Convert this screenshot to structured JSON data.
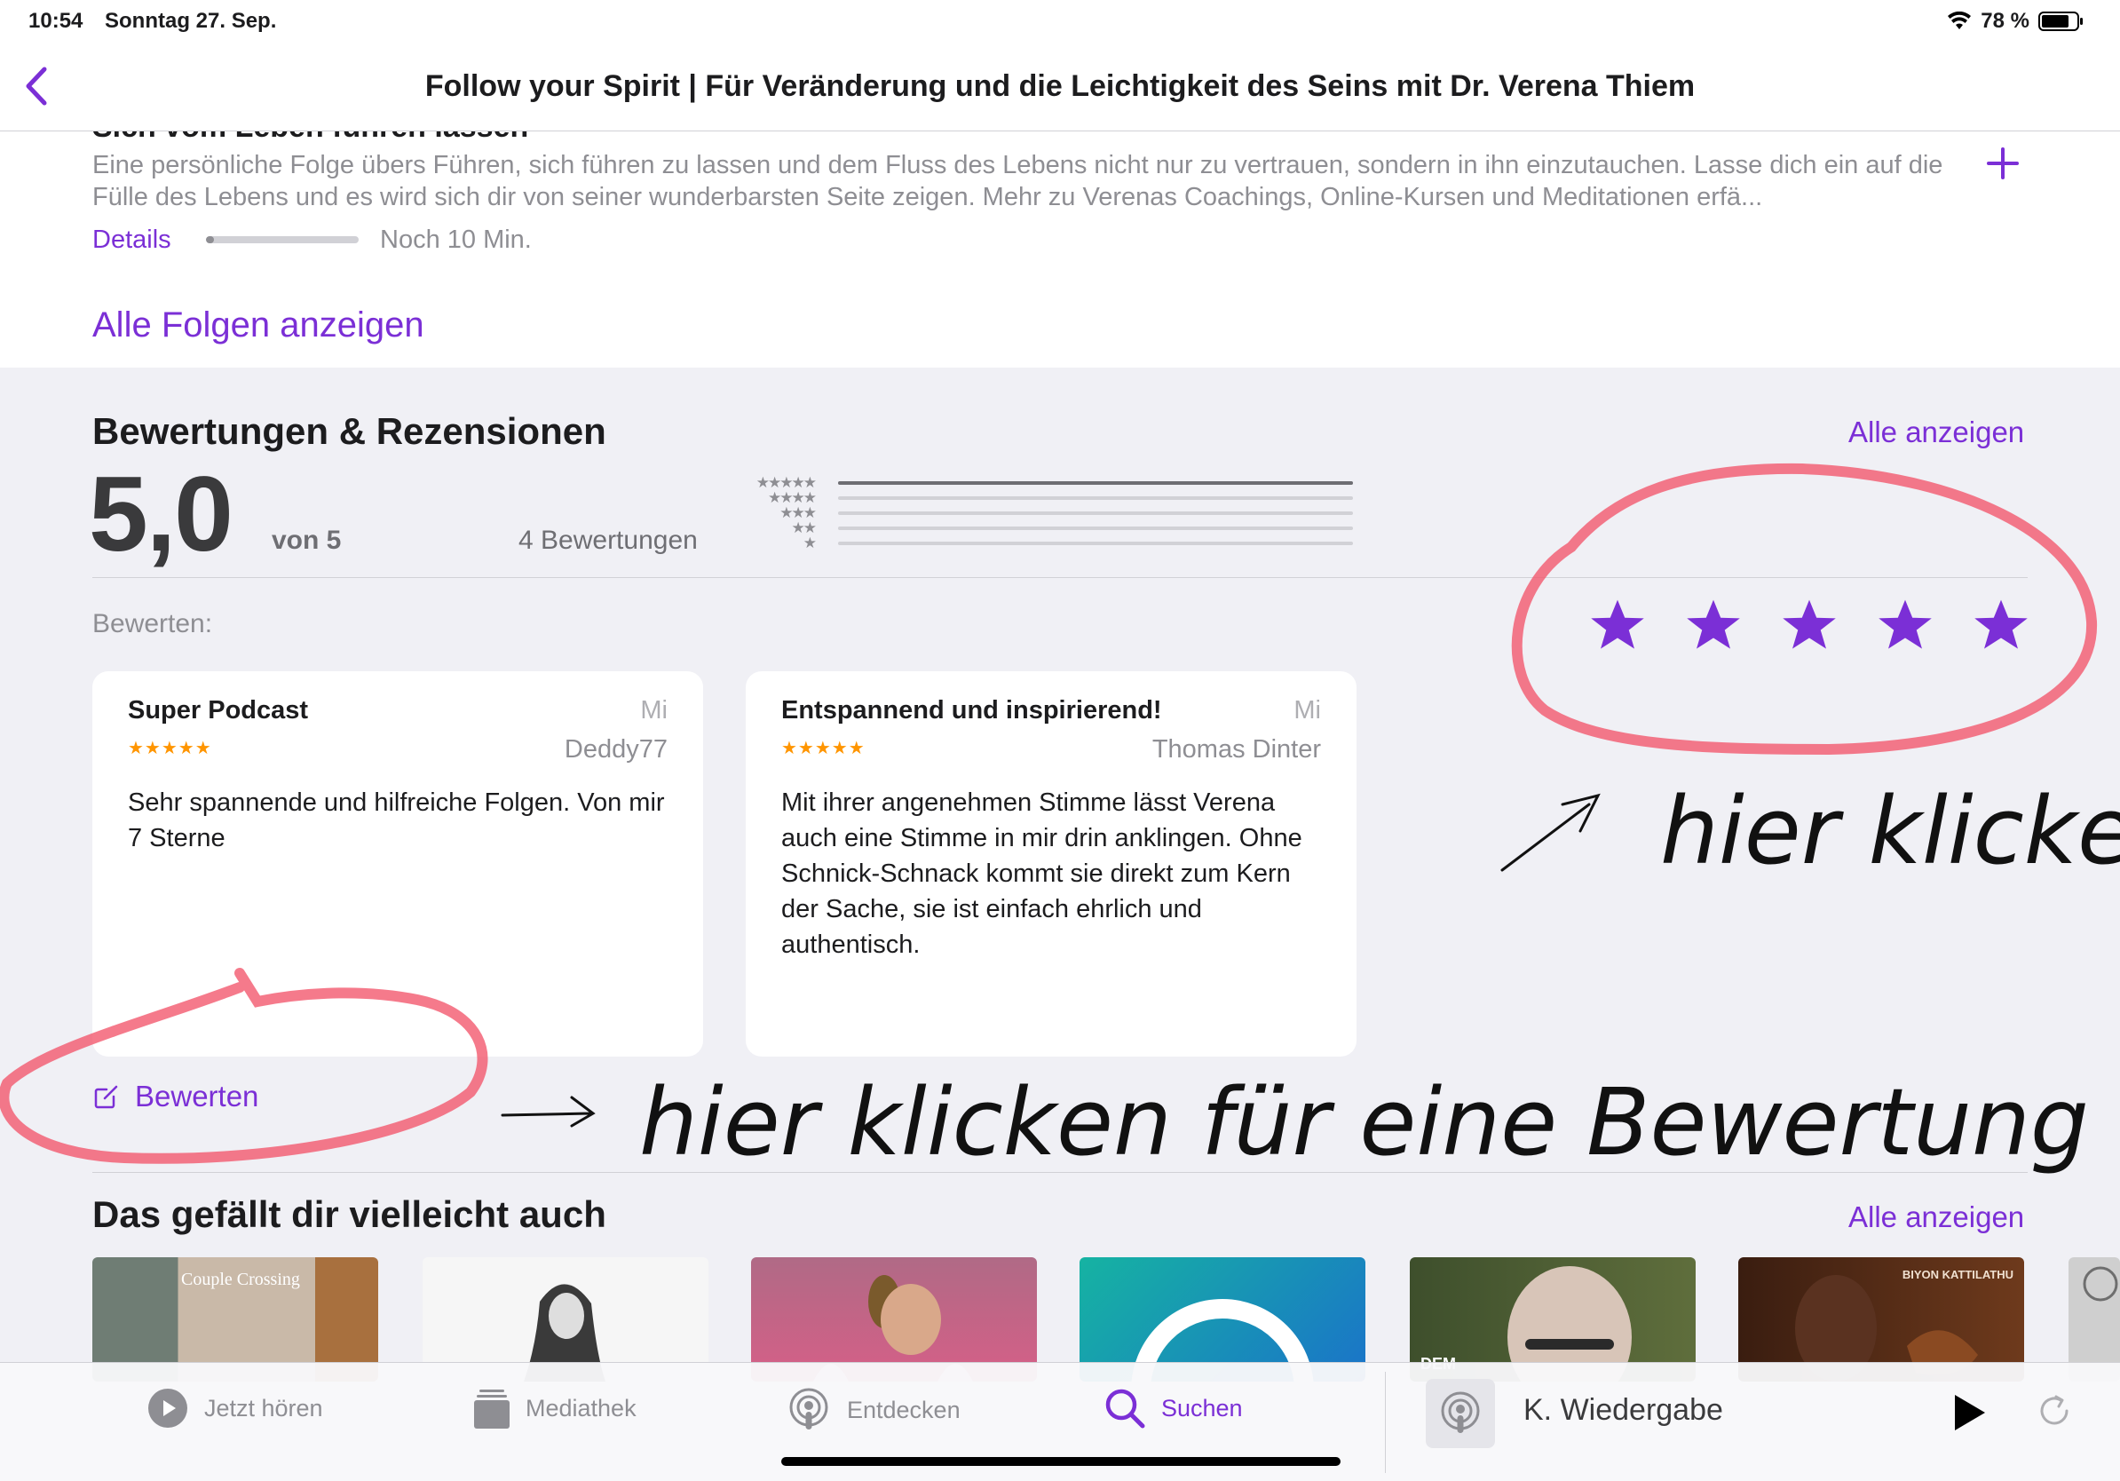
{
  "status_bar": {
    "time": "10:54",
    "date": "Sonntag 27. Sep.",
    "battery": "78 %"
  },
  "nav": {
    "title": "Follow your Spirit | Für Veränderung und die Leichtigkeit des Seins mit Dr. Verena Thiem"
  },
  "episode": {
    "title_clipped": "Sich vom Leben führen lassen",
    "description": "Eine persönliche Folge übers Führen, sich führen zu lassen und dem Fluss des Lebens nicht nur zu vertrauen, sondern in ihn einzutauchen. Lasse dich ein auf die Fülle des Lebens und es wird sich dir von seiner wunderbarsten Seite zeigen. Mehr zu Verenas Coachings, Online-Kursen und Meditationen erfä...",
    "details_label": "Details",
    "progress_fraction": 0.05,
    "remaining": "Noch 10 Min.",
    "all_episodes_label": "Alle Folgen anzeigen"
  },
  "ratings": {
    "title": "Bewertungen & Rezensionen",
    "show_all": "Alle anzeigen",
    "score": "5,0",
    "of_label": "von 5",
    "count_label": "4 Bewertungen",
    "histogram_fractions": [
      1.0,
      0,
      0,
      0,
      0
    ],
    "rate_label": "Bewerten:",
    "write_review_label": "Bewerten"
  },
  "reviews": [
    {
      "title": "Super Podcast",
      "date": "Mi",
      "stars": "★★★★★",
      "author": "Deddy77",
      "body": "Sehr spannende und hilfreiche Folgen. Von mir 7 Sterne"
    },
    {
      "title": "Entspannend und inspirierend!",
      "date": "Mi",
      "stars": "★★★★★",
      "author": "Thomas Dinter",
      "body": "Mit ihrer angenehmen Stimme lässt Verena auch eine Stimme in mir drin anklingen. Ohne Schnick-Schnack kommt sie direkt zum Kern der Sache, sie ist einfach ehrlich und authentisch."
    }
  ],
  "recommendations": {
    "title": "Das gefällt dir vielleicht auch",
    "show_all": "Alle anzeigen",
    "tiles": [
      {
        "label": "Couple Crossing",
        "color": "#8a6a4e"
      },
      {
        "label": "",
        "color": "#f4f4f4"
      },
      {
        "label": "",
        "color": "#c0577a"
      },
      {
        "label": "",
        "color": "#1aa3a0"
      },
      {
        "label": "DEM",
        "color": "#3e4f2c"
      },
      {
        "label": "BIYON KATTILATHU",
        "color": "#4a2514"
      }
    ]
  },
  "annotations": {
    "note_1": "hier klicken",
    "note_2": "hier klicken für eine Bewertung"
  },
  "tabbar": {
    "listen": "Jetzt hören",
    "library": "Mediathek",
    "browse": "Entdecken",
    "search": "Suchen",
    "now_playing": "K. Wiedergabe"
  },
  "colors": {
    "accent": "#7b2fd6",
    "review_star": "#ff9500",
    "annotation_red": "#f2546a"
  }
}
